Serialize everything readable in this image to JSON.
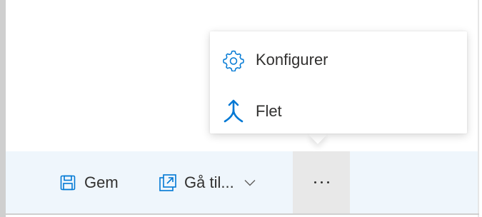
{
  "command_bar": {
    "save_label": "Gem",
    "save_icon": "save-icon",
    "goto_label": "Gå til...",
    "goto_icon": "open-in-new-icon",
    "goto_chevron_icon": "chevron-down-icon",
    "more_icon": "more-ellipsis-icon",
    "background": "#eff6fc"
  },
  "menu": {
    "items": [
      {
        "label": "Konfigurer",
        "icon": "gear-icon"
      },
      {
        "label": "Flet",
        "icon": "merge-icon"
      }
    ]
  },
  "colors": {
    "accent": "#0078d4",
    "text": "#323130"
  }
}
